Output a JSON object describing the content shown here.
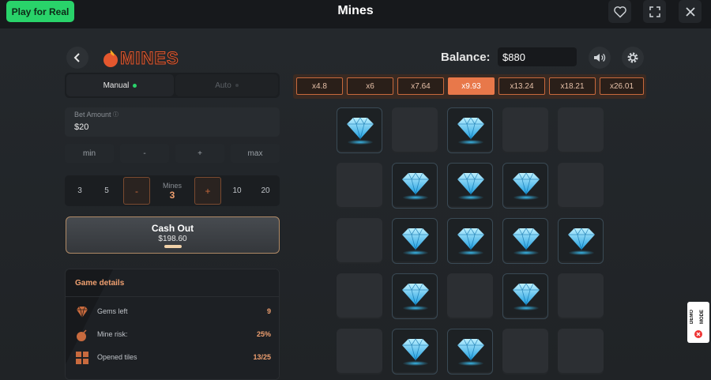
{
  "header": {
    "play_real_label": "Play for Real",
    "title": "Mines"
  },
  "game": {
    "logo_text": "MINES",
    "balance_label": "Balance:",
    "balance_value": "$880"
  },
  "mode": {
    "manual_label": "Manual",
    "auto_label": "Auto"
  },
  "bet": {
    "label": "Bet Amount",
    "value": "$20",
    "buttons": [
      "min",
      "-",
      "+",
      "max"
    ]
  },
  "mines_selector": {
    "presets_left": [
      "3",
      "5"
    ],
    "minus": "-",
    "label": "Mines",
    "count": "3",
    "plus": "+",
    "presets_right": [
      "10",
      "20"
    ]
  },
  "cashout": {
    "title": "Cash Out",
    "amount": "$198.60"
  },
  "details": {
    "title": "Game details",
    "rows": [
      {
        "label": "Gems left",
        "value": "9",
        "icon": "gem-icon"
      },
      {
        "label": "Mine risk:",
        "value": "25%",
        "icon": "bomb-icon"
      },
      {
        "label": "Opened tiles",
        "value": "13/25",
        "icon": "grid-icon"
      }
    ]
  },
  "multipliers": {
    "items": [
      "x4.8",
      "x6",
      "x7.64",
      "x9.93",
      "x13.24",
      "x18.21",
      "x26.01"
    ],
    "active_index": 3
  },
  "grid": {
    "opened": [
      [
        1,
        0,
        1,
        0,
        0
      ],
      [
        0,
        1,
        1,
        1,
        0
      ],
      [
        0,
        1,
        1,
        1,
        1
      ],
      [
        0,
        1,
        0,
        1,
        0
      ],
      [
        0,
        1,
        1,
        0,
        0
      ]
    ]
  },
  "demo": {
    "label": "DEMO MODE"
  },
  "colors": {
    "accent": "#e8784a",
    "play_green": "#29d36a",
    "gem_blue": "#3cc8ff"
  }
}
